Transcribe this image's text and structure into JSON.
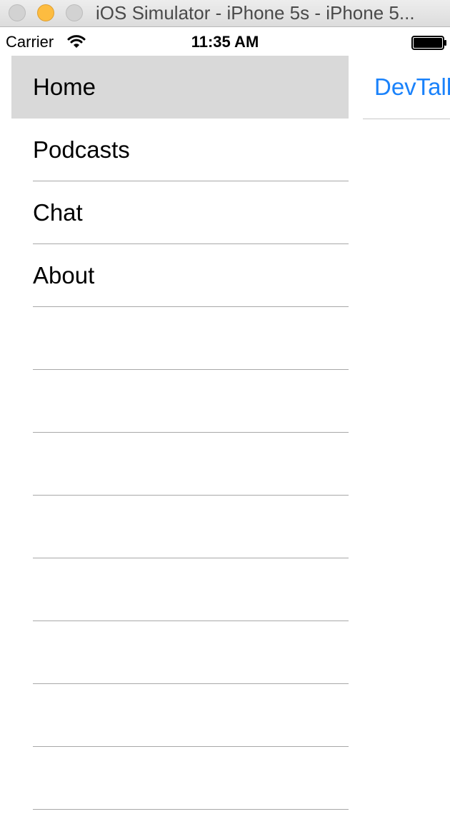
{
  "window": {
    "title": "iOS Simulator - iPhone 5s - iPhone 5..."
  },
  "status_bar": {
    "carrier": "Carrier",
    "time": "11:35 AM",
    "icons": [
      "wifi-icon",
      "battery-icon"
    ]
  },
  "menu": {
    "items": [
      {
        "label": "Home",
        "selected": true
      },
      {
        "label": "Podcasts",
        "selected": false
      },
      {
        "label": "Chat",
        "selected": false
      },
      {
        "label": "About",
        "selected": false
      },
      {
        "label": "",
        "selected": false
      },
      {
        "label": "",
        "selected": false
      },
      {
        "label": "",
        "selected": false
      },
      {
        "label": "",
        "selected": false
      },
      {
        "label": "",
        "selected": false
      },
      {
        "label": "",
        "selected": false
      },
      {
        "label": "",
        "selected": false
      },
      {
        "label": "",
        "selected": false
      }
    ]
  },
  "content": {
    "nav_title": "DevTalles"
  },
  "colors": {
    "accent": "#1a82fb",
    "selected_row": "#d9d9d9",
    "separator": "#a8a8a8",
    "traffic_minimize": "#fdbc40"
  }
}
